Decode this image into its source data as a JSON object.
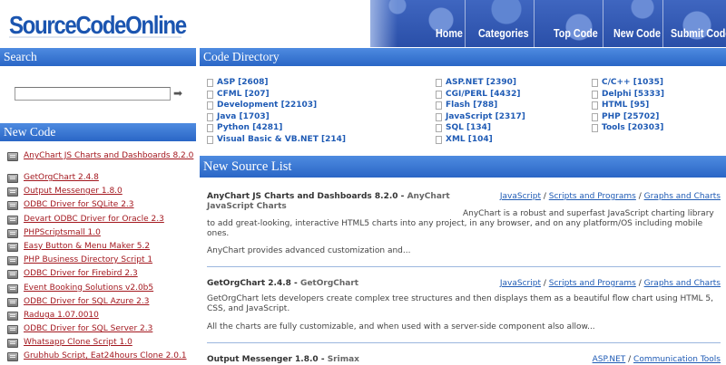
{
  "header": {
    "logo": "SourceCodeOnline",
    "nav": [
      "Home",
      "Categories",
      "Top Code",
      "New Code",
      "Submit Code"
    ]
  },
  "sidebar": {
    "search_title": "Search",
    "search_placeholder": "",
    "search_go_icon": "arrow-right-icon",
    "new_code_title": "New Code",
    "new_code_items": [
      "AnyChart JS Charts and Dashboards 8.2.0",
      "GetOrgChart 2.4.8",
      "Output Messenger 1.8.0",
      "ODBC Driver for SQLite 2.3",
      "Devart ODBC Driver for Oracle 2.3",
      "PHPScriptsmall 1.0",
      "Easy Button & Menu Maker 5.2",
      "PHP Business Directory Script 1",
      "ODBC Driver for Firebird 2.3",
      "Event Booking Solutions v2.0b5",
      "ODBC Driver for SQL Azure 2.3",
      "Raduga 1.07.0010",
      "ODBC Driver for SQL Server 2.3",
      "Whatsapp Clone Script 1.0",
      "Grubhub Script, Eat24hours Clone 2.0.1"
    ]
  },
  "directory": {
    "title": "Code Directory",
    "columns": [
      [
        "ASP [2608]",
        "CFML [207]",
        "Development [22103]",
        "Java [1703]",
        "Python [4281]",
        "Visual Basic & VB.NET [214]"
      ],
      [
        "ASP.NET [2390]",
        "CGI/PERL [4432]",
        "Flash [788]",
        "JavaScript [2317]",
        "SQL [134]",
        "XML [104]"
      ],
      [
        "C/C++ [1035]",
        "Delphi [5333]",
        "HTML [95]",
        "PHP [25702]",
        "Tools [20303]"
      ]
    ]
  },
  "new_source_list": {
    "title": "New Source List",
    "entries": [
      {
        "title": "AnyChart JS Charts and Dashboards 8.2.0",
        "author": "AnyChart JavaScript Charts",
        "cats": [
          "JavaScript",
          "Scripts and Programs",
          "Graphs and Charts"
        ],
        "desc1": "AnyChart is a robust and superfast JavaScript charting library to add great-looking, interactive HTML5 charts into any project, in any browser, and on any platform/OS including mobile ones.",
        "desc2": "AnyChart provides advanced customization and..."
      },
      {
        "title": "GetOrgChart 2.4.8",
        "author": "GetOrgChart",
        "cats": [
          "JavaScript",
          "Scripts and Programs",
          "Graphs and Charts"
        ],
        "desc1": "GetOrgChart lets developers create complex tree structures and then displays them as a beautiful flow chart using HTML 5, CSS, and JavaScript.",
        "desc2": "All the charts are fully customizable, and when used with a server-side component also allow..."
      },
      {
        "title": "Output Messenger 1.8.0",
        "author": "Srimax",
        "cats": [
          "ASP.NET",
          "Communication Tools"
        ],
        "desc1": "",
        "desc2": ""
      }
    ]
  },
  "colors": {
    "accent": "#2a66c6",
    "link_dark_red": "#a3171e",
    "link_blue": "#1f5bb5"
  }
}
